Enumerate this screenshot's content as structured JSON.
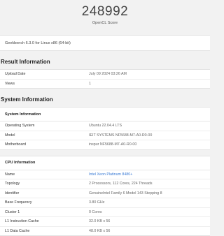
{
  "score": {
    "value": "248992",
    "label": "OpenCL Score"
  },
  "version": "Geekbench 6.3.0 for Linux x86 (64-bit)",
  "result_information": {
    "title": "Result Information",
    "rows": [
      {
        "key": "Upload Date",
        "value": "July 09 2024 03:26 AM"
      },
      {
        "key": "Views",
        "value": "1"
      }
    ]
  },
  "system_information": {
    "title": "System Information",
    "system": {
      "header": "System Information",
      "rows": [
        {
          "key": "Operating System",
          "value": "Ubuntu 22.04.4 LTS"
        },
        {
          "key": "Model",
          "value": "IEIT SYSTEMS NF5688-M7-A0-R0-00"
        },
        {
          "key": "Motherboard",
          "value": "inspur NF5688-M7-A0-R0-00"
        }
      ]
    },
    "cpu": {
      "header": "CPU Information",
      "rows": [
        {
          "key": "Name",
          "value": "Intel Xeon Platinum 8480+"
        },
        {
          "key": "Topology",
          "value": "2 Processors, 112 Cores, 224 Threads"
        },
        {
          "key": "Identifier",
          "value": "GenuineIntel Family 6 Model 143 Stepping 8"
        },
        {
          "key": "Base Frequency",
          "value": "3.80 GHz"
        },
        {
          "key": "Cluster 1",
          "value": "0 Cores"
        },
        {
          "key": "L1 Instruction Cache",
          "value": "32.0 KB x 56"
        },
        {
          "key": "L1 Data Cache",
          "value": "48.0 KB x 56"
        }
      ]
    }
  },
  "colors": {
    "link": "#3a7bd5",
    "background": "#f2f2f2"
  }
}
